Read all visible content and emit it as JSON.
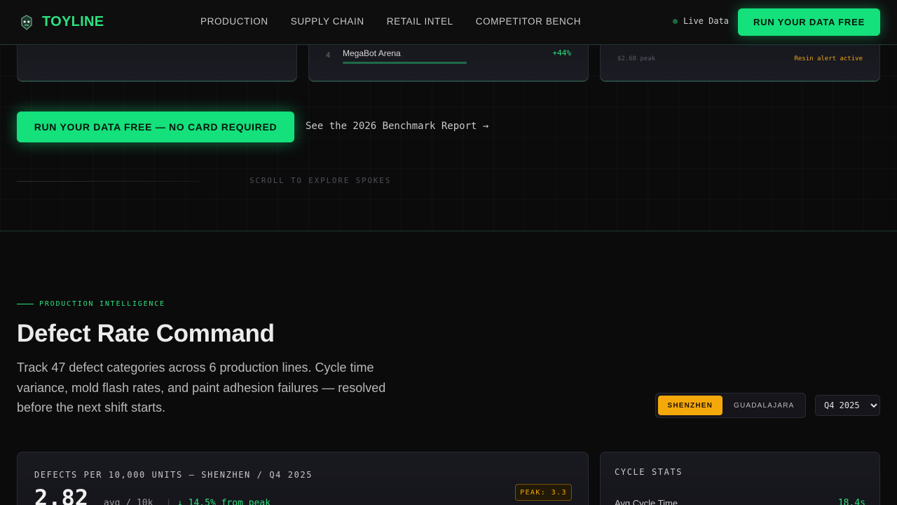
{
  "colors": {
    "accent": "#14e07c",
    "warning": "#f5a80a",
    "background": "#0b0b0c"
  },
  "nav": {
    "brand_icon": "robot-mascot-icon",
    "brand": "TOYLINE",
    "links": [
      "PRODUCTION",
      "SUPPLY CHAIN",
      "RETAIL INTEL",
      "COMPETITOR BENCH"
    ],
    "live_label": "Live Data",
    "cta": "RUN YOUR DATA FREE"
  },
  "hero": {
    "ranking": {
      "rank": "4",
      "name": "MegaBot Arena",
      "change": "+44%",
      "bar_fraction": 0.51
    },
    "resin": {
      "peak_label": "$2.68 peak",
      "alert": "Resin alert active"
    },
    "cta": "RUN YOUR DATA FREE — NO CARD REQUIRED",
    "report_link": "See the 2026 Benchmark Report →",
    "scroll_hint": "SCROLL TO EXPLORE SPOKES"
  },
  "production": {
    "eyebrow": "PRODUCTION INTELLIGENCE",
    "title": "Defect Rate Command",
    "description": "Track 47 defect categories across 6 production lines. Cycle time variance, mold flash rates, and paint adhesion failures — resolved before the next shift starts.",
    "plants": [
      "SHENZHEN",
      "GUADALAJARA"
    ],
    "active_plant": "SHENZHEN",
    "period": "Q4 2025",
    "period_options": [
      "Q4 2025"
    ],
    "defects": {
      "label": "DEFECTS PER 10,000 UNITS — SHENZHEN / Q4 2025",
      "value": "2.82",
      "unit": "avg / 10k",
      "separator": "|",
      "delta": "↓ 14.5% from peak",
      "peak_badge": "PEAK: 3.3"
    },
    "cycle_stats": {
      "label": "CYCLE STATS",
      "rows": [
        {
          "name": "Avg Cycle Time",
          "value": "18.4s"
        }
      ]
    }
  }
}
